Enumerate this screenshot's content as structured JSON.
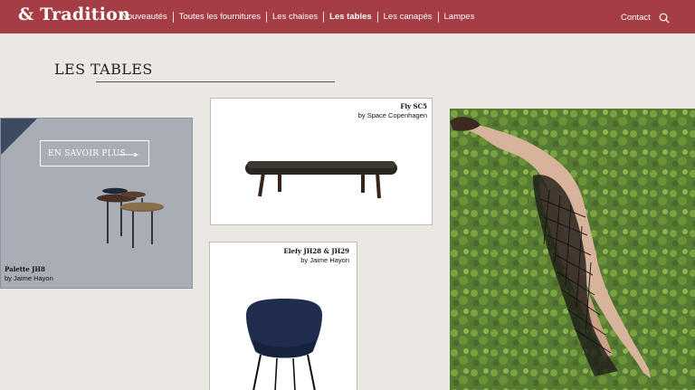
{
  "header": {
    "logo": "& Tradition",
    "nav": [
      {
        "label": "Nouveautés",
        "active": false
      },
      {
        "label": "Toutes les fournitures",
        "active": false
      },
      {
        "label": "Les chaises",
        "active": false
      },
      {
        "label": "Les tables",
        "active": true
      },
      {
        "label": "Les canapés",
        "active": false
      },
      {
        "label": "Lampes",
        "active": false
      }
    ],
    "contact": "Contact",
    "search_icon": "search-icon"
  },
  "page": {
    "title": "LES TABLES"
  },
  "cards": {
    "palette": {
      "cta": "EN SAVOIR PLUS",
      "name": "Palette JH8",
      "designer": "by Jaime Hayon"
    },
    "fly": {
      "name": "Fly SC5",
      "designer": "by Space Copenhagen"
    },
    "elefy": {
      "name": "Elefy JH28 & JH29",
      "designer": "by Jaime Hayon"
    }
  },
  "colors": {
    "header_bg": "#a53d45",
    "page_bg": "#ebe7e2",
    "palette_card_bg": "#a8adb6",
    "corner_accent": "#3d4861"
  }
}
